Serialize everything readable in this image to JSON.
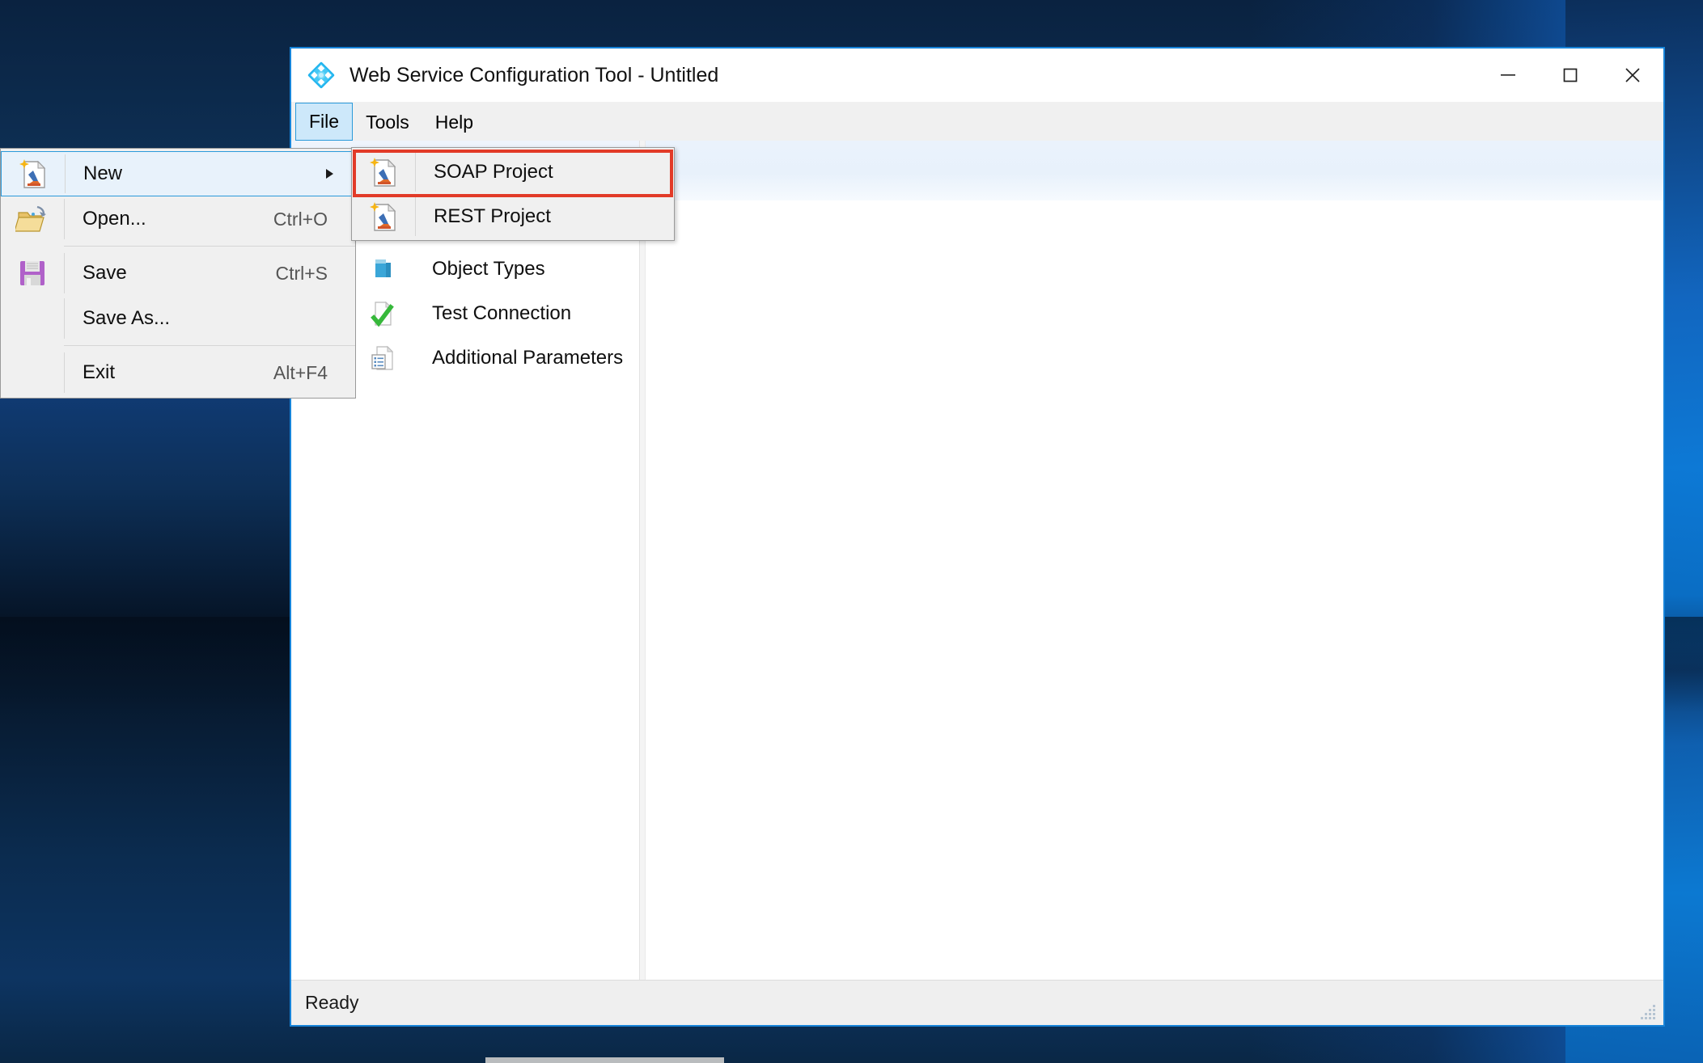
{
  "window": {
    "title": "Web Service Configuration Tool - Untitled",
    "app_icon": "diamond-node-icon",
    "controls": {
      "minimize": "minimize-icon",
      "maximize": "maximize-icon",
      "close": "close-icon"
    }
  },
  "menu_bar": {
    "items": [
      {
        "label": "File",
        "active": true
      },
      {
        "label": "Tools",
        "active": false
      },
      {
        "label": "Help",
        "active": false
      }
    ]
  },
  "file_menu": {
    "items": [
      {
        "label": "New",
        "accel": "",
        "icon": "new-document-icon",
        "submenu": true,
        "highlighted": true
      },
      {
        "label": "Open...",
        "accel": "Ctrl+O",
        "icon": "open-folder-icon",
        "submenu": false,
        "highlighted": false
      },
      {
        "label": "Save",
        "accel": "Ctrl+S",
        "icon": "save-floppy-icon",
        "submenu": false,
        "highlighted": false
      },
      {
        "label": "Save As...",
        "accel": "",
        "icon": "",
        "submenu": false,
        "highlighted": false
      },
      {
        "label": "Exit",
        "accel": "Alt+F4",
        "icon": "",
        "submenu": false,
        "highlighted": false
      }
    ]
  },
  "new_submenu": {
    "items": [
      {
        "label": "SOAP Project",
        "icon": "new-document-icon",
        "annotated": true
      },
      {
        "label": "REST Project",
        "icon": "new-document-icon",
        "annotated": false
      }
    ]
  },
  "tools_menu": {
    "items": [
      {
        "label": "Object Types",
        "icon": "object-types-icon"
      },
      {
        "label": "Test Connection",
        "icon": "test-connection-check-icon"
      },
      {
        "label": "Additional Parameters",
        "icon": "additional-parameters-icon"
      }
    ]
  },
  "status_bar": {
    "text": "Ready",
    "grip": "resize-grip-icon"
  },
  "colors": {
    "window_border": "#1683d8",
    "menu_background": "#f0f0f0",
    "highlight_fill": "#cde8fa",
    "highlight_border": "#2a9ada",
    "annotation": "#e23b28",
    "desktop": "#0b2744",
    "panel_header": "#eaf2fc"
  }
}
